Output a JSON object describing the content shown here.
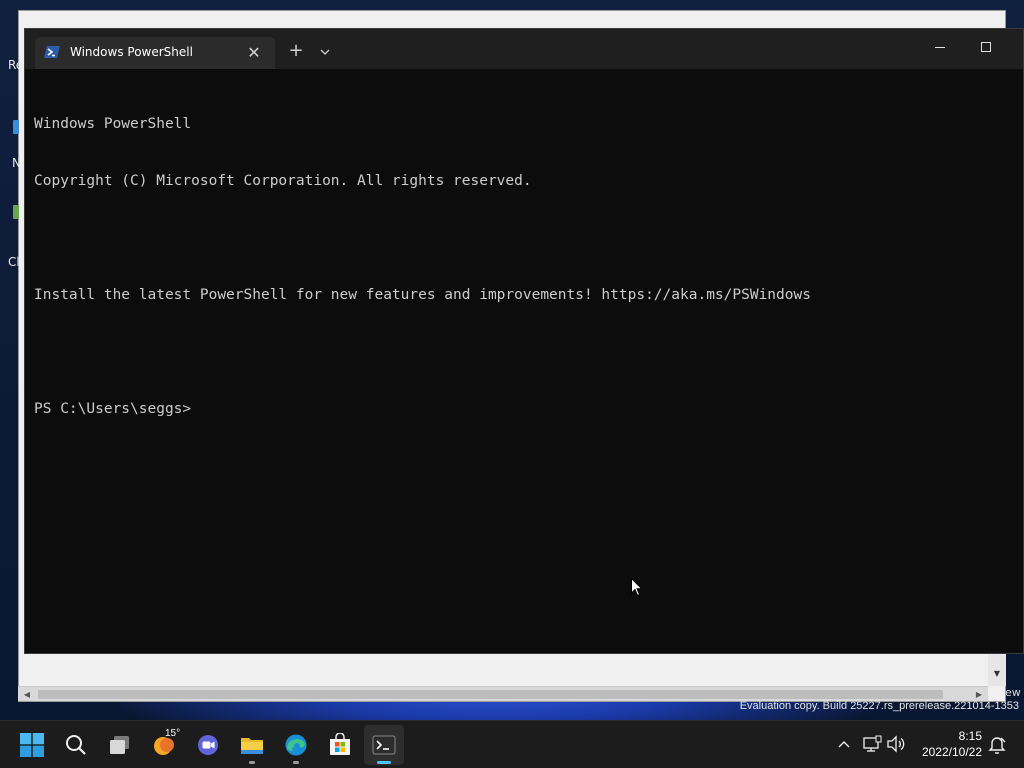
{
  "desktop": {
    "icon_labels": [
      "Re",
      "N",
      "Cl"
    ],
    "background_peek_text": "ew"
  },
  "terminal": {
    "tab_title": "Windows PowerShell",
    "tab_icon": "powershell-icon",
    "lines": [
      "Windows PowerShell",
      "Copyright (C) Microsoft Corporation. All rights reserved.",
      "",
      "Install the latest PowerShell for new features and improvements! https://aka.ms/PSWindows",
      "",
      "PS C:\\Users\\seggs>"
    ],
    "colors": {
      "background": "#0c0c0c",
      "text": "#cccccc",
      "titlebar": "#1f1f1f",
      "tab": "#2b2b2b"
    }
  },
  "watermark": "Evaluation copy. Build 25227.rs_prerelease.221014-1353",
  "taskbar": {
    "items": [
      {
        "name": "start-button",
        "icon": "windows-logo-icon"
      },
      {
        "name": "search-button",
        "icon": "search-icon"
      },
      {
        "name": "task-view-button",
        "icon": "task-view-icon"
      },
      {
        "name": "widgets-button",
        "icon": "weather-icon"
      },
      {
        "name": "chat-button",
        "icon": "teams-chat-icon"
      },
      {
        "name": "file-explorer-button",
        "icon": "folder-icon"
      },
      {
        "name": "edge-button",
        "icon": "edge-icon"
      },
      {
        "name": "store-button",
        "icon": "store-icon"
      },
      {
        "name": "terminal-button",
        "icon": "terminal-icon"
      }
    ],
    "weather_temp": "15°",
    "tray": {
      "chevron": "chevron-up-icon",
      "network": "network-icon",
      "volume": "volume-icon",
      "notification": "notification-icon"
    },
    "clock": {
      "time": "8:15",
      "date": "2022/10/22"
    },
    "accent": "#4cc2ff"
  }
}
